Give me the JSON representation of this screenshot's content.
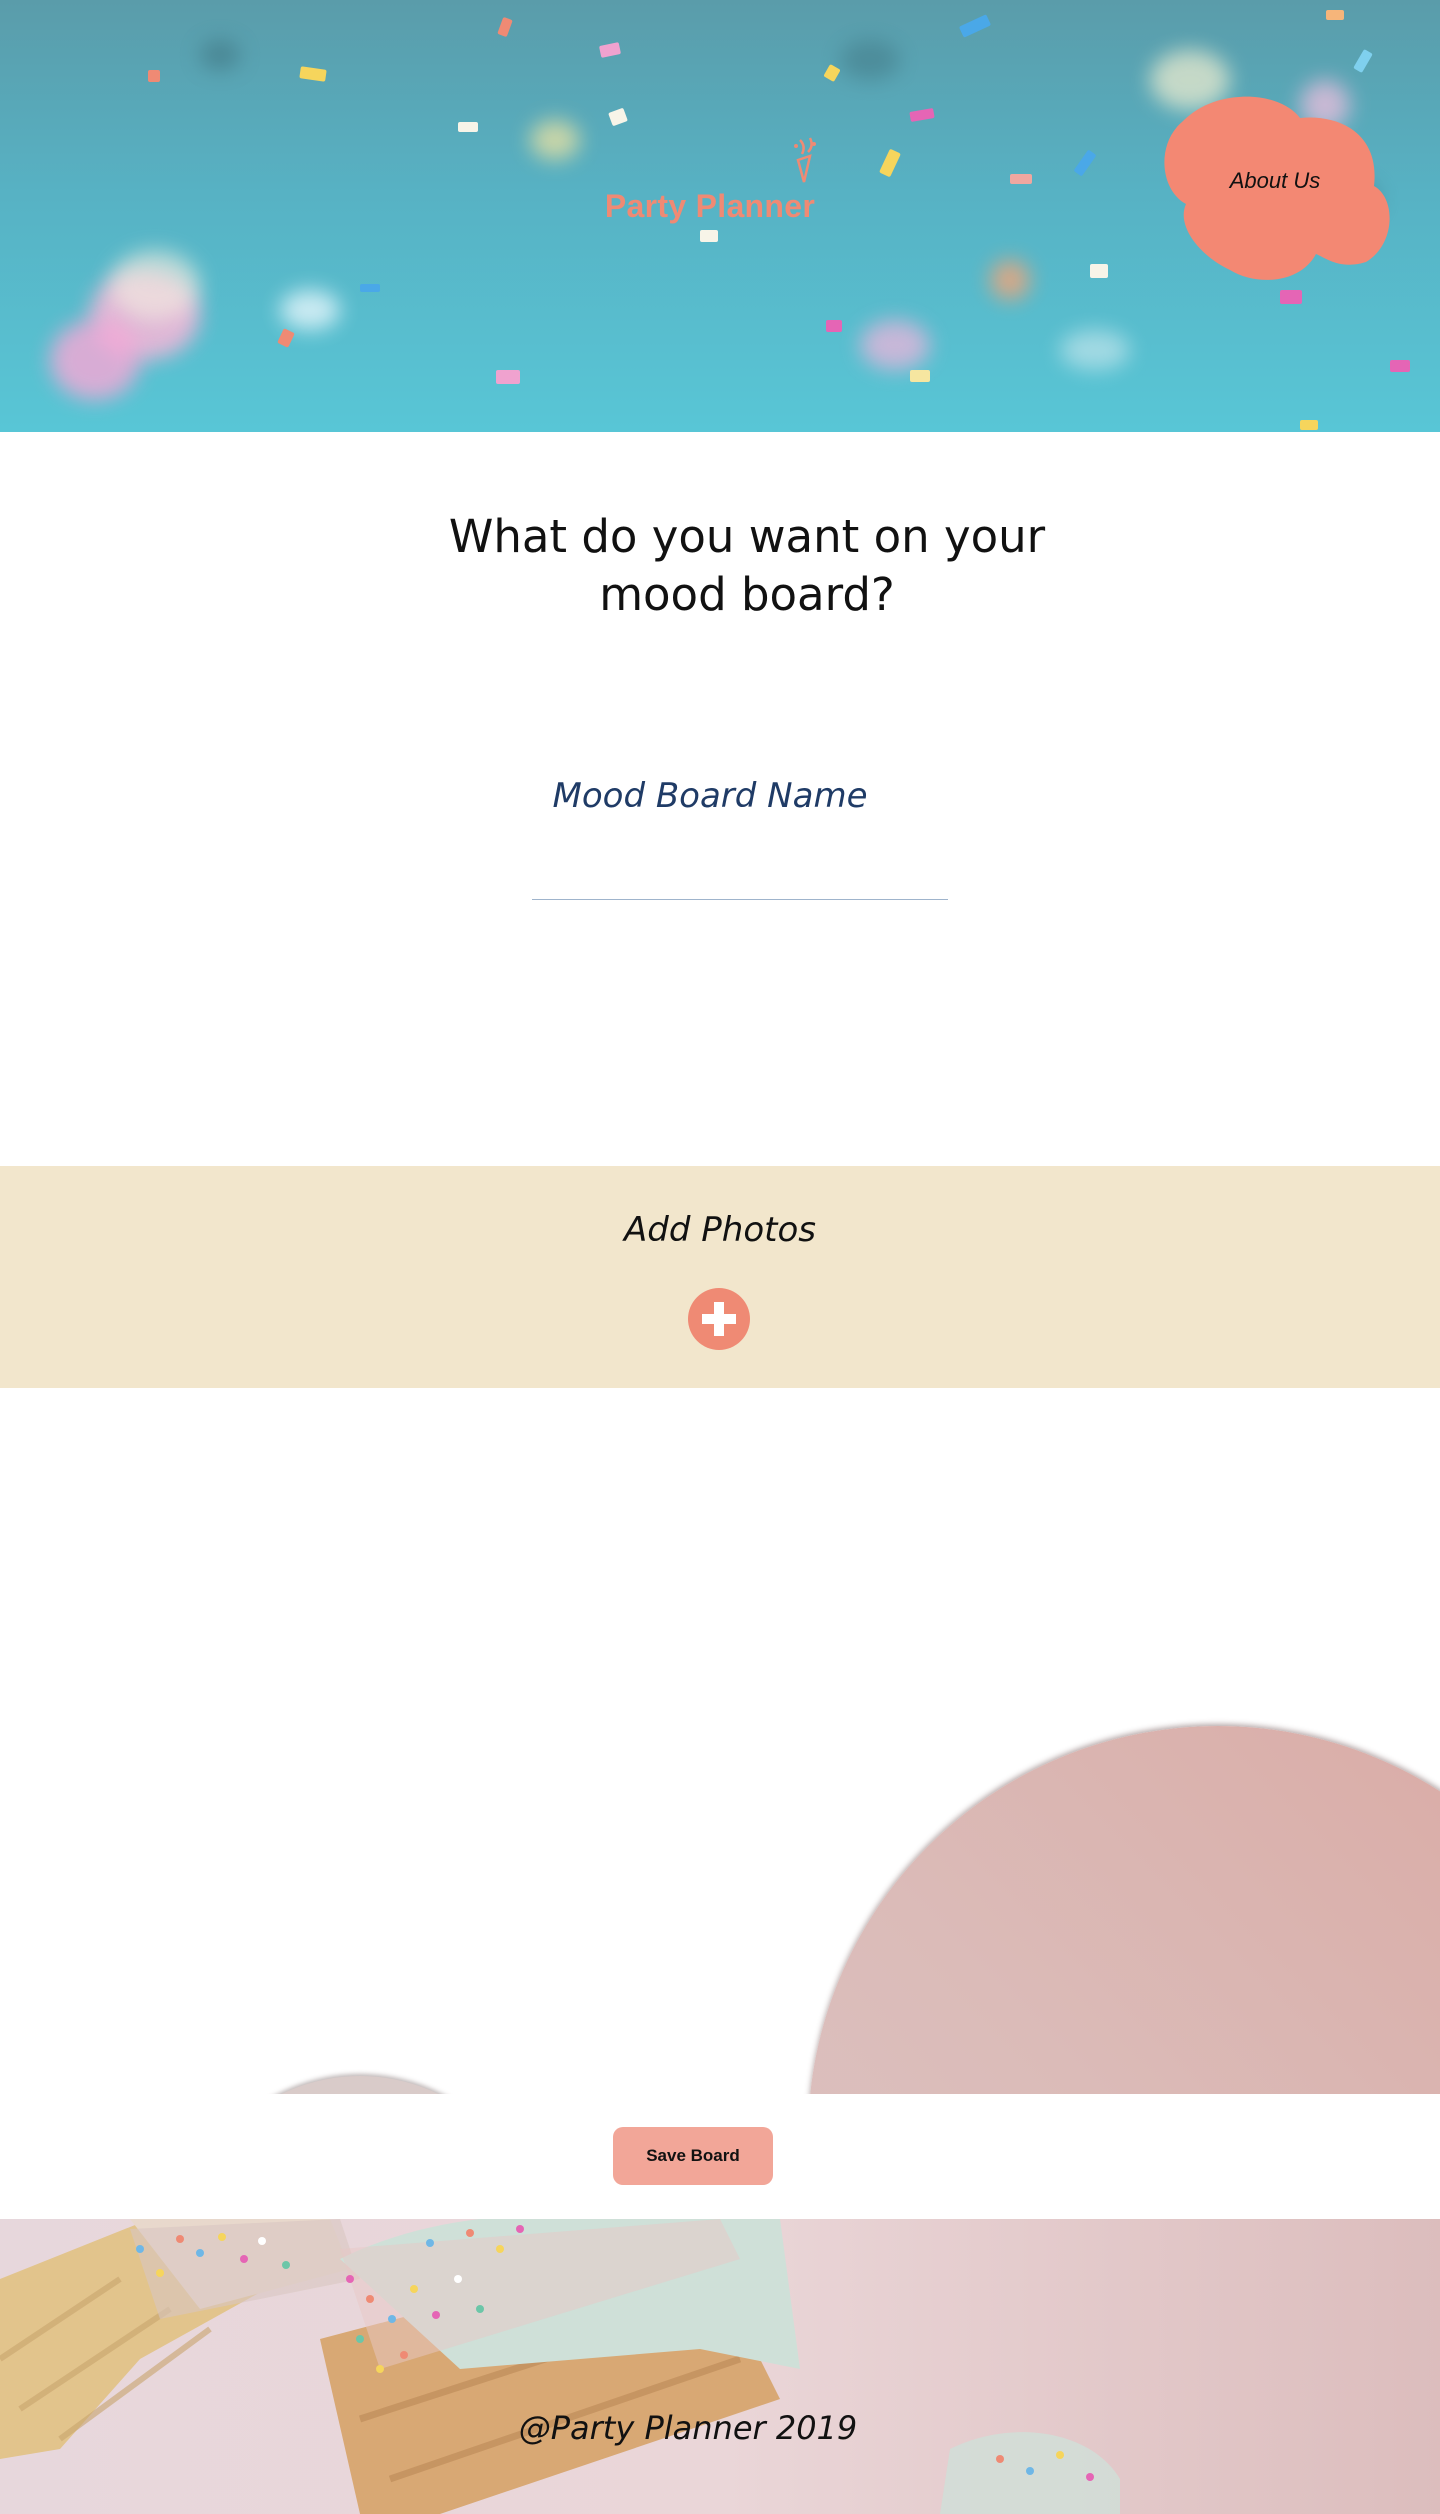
{
  "header": {
    "logo_text": "Party Planner",
    "about_label": "About Us"
  },
  "prompt": {
    "title_line1": "What do you want on your",
    "title_line2": "mood board?",
    "board_name_label": "Mood Board Name",
    "board_name_value": ""
  },
  "photos": {
    "label": "Add Photos",
    "add_icon": "plus-circle-icon"
  },
  "actions": {
    "save_label": "Save Board"
  },
  "footer": {
    "copyright": "@Party Planner 2019"
  },
  "colors": {
    "accent": "#ef8a74",
    "band": "#f2e6cc",
    "save_button": "#f2a698",
    "label_blue": "#1f3b66",
    "hero_teal": "#57b2c4"
  }
}
